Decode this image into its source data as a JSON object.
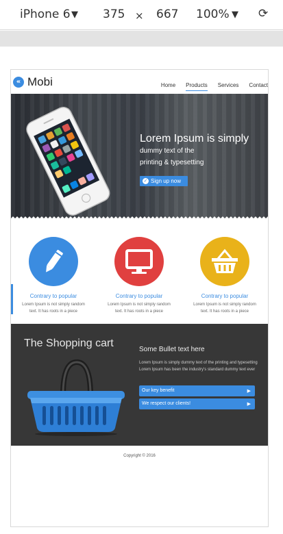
{
  "devtools": {
    "device": "iPhone 6",
    "caret": "▼",
    "width": "375",
    "times": "×",
    "height": "667",
    "zoom": "100%",
    "rotate_icon": "⟳"
  },
  "header": {
    "logo_glyph": "«",
    "logo_text": "Mobi",
    "nav": [
      "Home",
      "Products",
      "Services",
      "Contact"
    ],
    "active_nav": "Products"
  },
  "hero": {
    "title": "Lorem Ipsum is simply",
    "subtitle_line1": "dummy text of the",
    "subtitle_line2": "printing & typesetting",
    "button_label": "Sign up now",
    "check_glyph": "✓"
  },
  "features": [
    {
      "title": "Contrary to popular",
      "desc": "Lorem Ipsum is not simply random text. It has roots in a piece",
      "color": "#3b8ce0",
      "icon": "pencil-icon"
    },
    {
      "title": "Contrary to popular",
      "desc": "Lorem Ipsum is not simply random text. It has roots in a piece",
      "color": "#e0403f",
      "icon": "monitor-icon"
    },
    {
      "title": "Contrary to popular",
      "desc": "Lorem Ipsum is not simply random text. It has roots in a piece",
      "color": "#e9b21a",
      "icon": "basket-icon"
    }
  ],
  "cart": {
    "title": "The Shopping cart",
    "bullet_title": "Some Bullet text here",
    "bullet_desc": "Lorem Ipsum is simply dummy text of the printing and typesetting Lorem Ipsum has been the industry's standard dummy text ever",
    "buttons": [
      "Our key benefit",
      "We respect our clients!"
    ],
    "arrow_glyph": "▶"
  },
  "footer": {
    "copyright": "Copyright © 2016"
  }
}
